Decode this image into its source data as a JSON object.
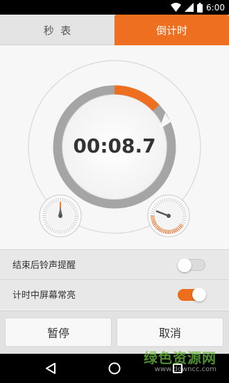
{
  "status_bar": {
    "time": "6:00"
  },
  "tabs": [
    {
      "label": "秒  表",
      "active": false
    },
    {
      "label": "倒计时",
      "active": true
    }
  ],
  "timer": {
    "display": "00:08.7",
    "progress_fraction": 0.13
  },
  "settings": [
    {
      "label": "结束后铃声提醒",
      "enabled": false
    },
    {
      "label": "计时中屏幕常亮",
      "enabled": true
    }
  ],
  "buttons": {
    "pause": "暂停",
    "cancel": "取消"
  },
  "watermark": {
    "title": "绿色资源网",
    "url": "www.downcc.com"
  },
  "colors": {
    "accent": "#ee6f20",
    "ring": "#a3a3a3",
    "background": "#f7f7f7"
  }
}
